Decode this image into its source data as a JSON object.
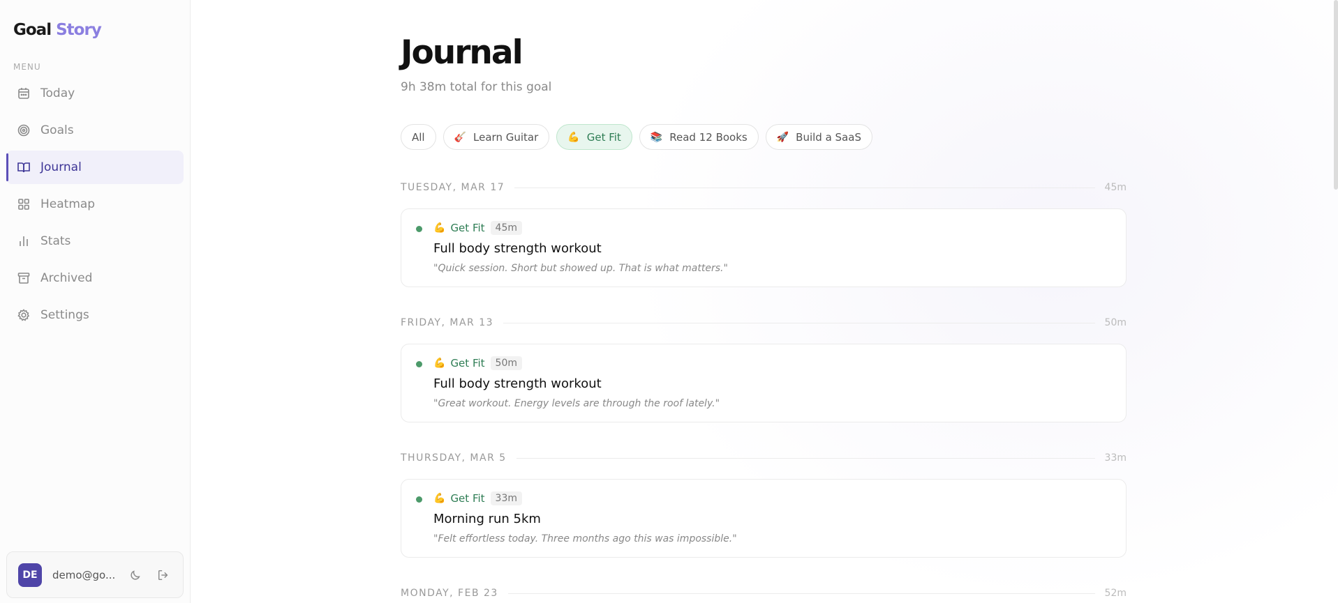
{
  "sidebar": {
    "logo_part1": "Goal",
    "logo_part2": "Story",
    "menu_label": "MENU",
    "items": [
      {
        "label": "Today",
        "icon": "calendar-icon"
      },
      {
        "label": "Goals",
        "icon": "target-icon"
      },
      {
        "label": "Journal",
        "icon": "book-icon",
        "active": true
      },
      {
        "label": "Heatmap",
        "icon": "grid-icon"
      },
      {
        "label": "Stats",
        "icon": "bar-chart-icon"
      },
      {
        "label": "Archived",
        "icon": "archive-icon"
      },
      {
        "label": "Settings",
        "icon": "gear-icon"
      }
    ],
    "user": {
      "initials": "DE",
      "email": "demo@go..."
    }
  },
  "main": {
    "title": "Journal",
    "subtitle": "9h 38m total for this goal",
    "filters": [
      {
        "label": "All",
        "emoji": ""
      },
      {
        "label": "Learn Guitar",
        "emoji": "🎸"
      },
      {
        "label": "Get Fit",
        "emoji": "💪",
        "active": true
      },
      {
        "label": "Read 12 Books",
        "emoji": "📚"
      },
      {
        "label": "Build a SaaS",
        "emoji": "🚀"
      }
    ],
    "days": [
      {
        "date": "TUESDAY, MAR 17",
        "total": "45m",
        "entry": {
          "goal": "Get Fit",
          "emoji": "💪",
          "duration": "45m",
          "title": "Full body strength workout",
          "note": "\"Quick session. Short but showed up. That is what matters.\""
        }
      },
      {
        "date": "FRIDAY, MAR 13",
        "total": "50m",
        "entry": {
          "goal": "Get Fit",
          "emoji": "💪",
          "duration": "50m",
          "title": "Full body strength workout",
          "note": "\"Great workout. Energy levels are through the roof lately.\""
        }
      },
      {
        "date": "THURSDAY, MAR 5",
        "total": "33m",
        "entry": {
          "goal": "Get Fit",
          "emoji": "💪",
          "duration": "33m",
          "title": "Morning run 5km",
          "note": "\"Felt effortless today. Three months ago this was impossible.\""
        }
      },
      {
        "date": "MONDAY, FEB 23",
        "total": "52m"
      }
    ]
  },
  "colors": {
    "accent": "#5b4fb8",
    "goal_green": "#2e7d54",
    "logo_purple": "#8b7fe0"
  }
}
